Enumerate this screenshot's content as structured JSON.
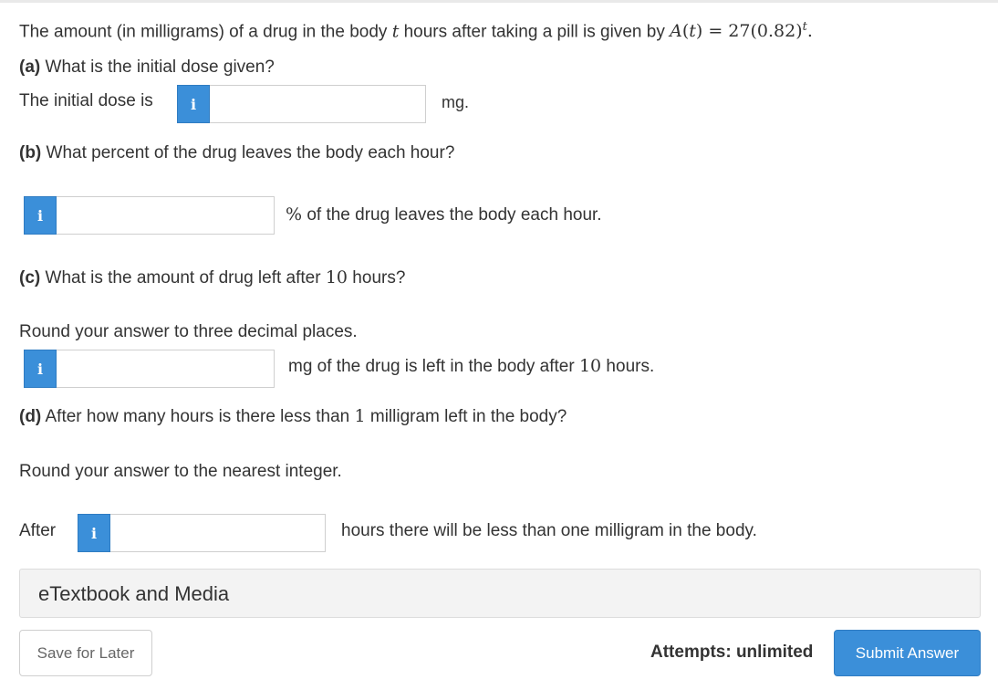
{
  "question": {
    "intro_prefix": "The amount (in milligrams) of a drug in the body ",
    "intro_var": "t",
    "intro_middle": " hours after taking a pill is given by ",
    "formula_lhs": "A",
    "formula_arg": "t",
    "formula_rhs": "= 27(0.82)",
    "formula_exp": "t",
    "formula_end": "."
  },
  "part_a": {
    "label": "(a)",
    "question": " What is the initial dose given?",
    "prefix": "The initial dose is",
    "info": "i",
    "input_value": "",
    "suffix": "mg."
  },
  "part_b": {
    "label": "(b)",
    "question": " What percent of the drug leaves the body each hour?",
    "info": "i",
    "input_value": "",
    "suffix_symbol": "%",
    "suffix": " of the drug leaves the body each hour."
  },
  "part_c": {
    "label": "(c)",
    "question_prefix": " What is the amount of drug left after ",
    "question_number": "10",
    "question_suffix": " hours?",
    "round_note": "Round your answer to three decimal places.",
    "info": "i",
    "input_value": "",
    "suffix_prefix": "mg of the drug is left in the body after ",
    "suffix_number": "10",
    "suffix_suffix": " hours."
  },
  "part_d": {
    "label": "(d)",
    "question_prefix": " After how many hours is there less than ",
    "question_number": "1",
    "question_suffix": " milligram left in the body?",
    "round_note": "Round your answer to the nearest integer.",
    "prefix": "After",
    "info": "i",
    "input_value": "",
    "suffix": "hours there will be less than one milligram in the body."
  },
  "etextbook": {
    "label": "eTextbook and Media"
  },
  "footer": {
    "save_label": "Save for Later",
    "attempts_label": "Attempts: unlimited",
    "submit_label": "Submit Answer"
  },
  "colors": {
    "accent": "#3b8fd9",
    "text": "#333333",
    "panel_bg": "#f3f3f3"
  }
}
